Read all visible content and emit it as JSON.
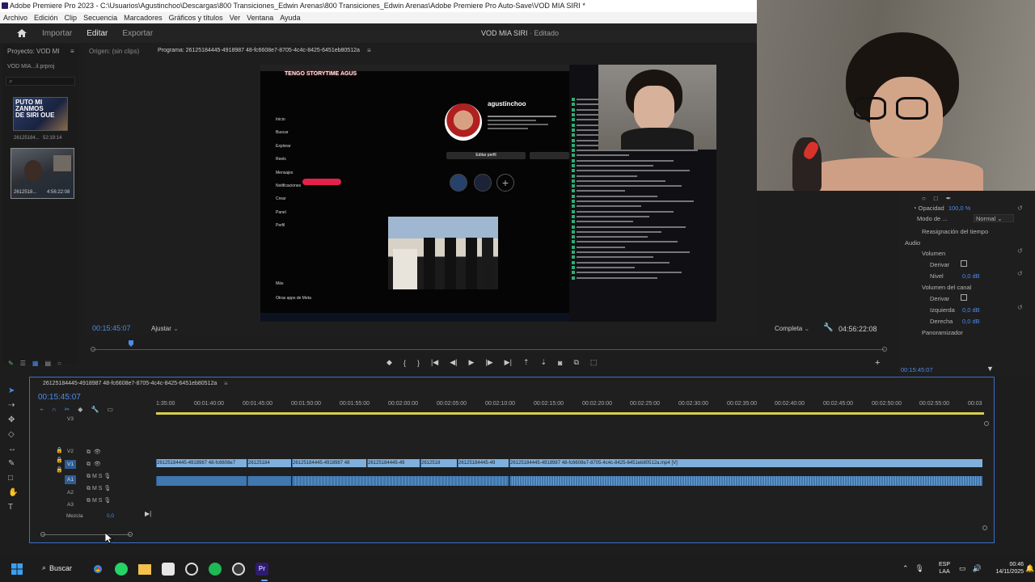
{
  "window": {
    "title": "Adobe Premiere Pro 2023 - C:\\Usuarios\\Agustinchoo\\Descargas\\800 Transiciones_Edwin Arenas\\800 Transiciones_Edwin Arenas\\Adobe Premiere Pro Auto-Save\\VOD MIA SIRI *"
  },
  "menu": [
    "Archivo",
    "Edición",
    "Clip",
    "Secuencia",
    "Marcadores",
    "Gráficos y títulos",
    "Ver",
    "Ventana",
    "Ayuda"
  ],
  "workspaces": {
    "home": "home-icon",
    "tabs": [
      "Importar",
      "Editar",
      "Exportar"
    ],
    "active": "Editar",
    "project_title": "VOD MIA SIRI",
    "status": "Editado"
  },
  "project_panel": {
    "tab": "Proyecto: VOD MI",
    "file": "VOD MIA...il.prproj",
    "items": [
      {
        "name": "26125184...",
        "duration": "52:19:14"
      },
      {
        "name": "2612518...",
        "duration": "4:56:22:08"
      }
    ]
  },
  "source_tab": "Origen: (sin clips)",
  "program_tab": "Programa: 26125184445-4918987 48-fc6608e7-8705-4c4c-8425-6451eb80512a",
  "program": {
    "timecode": "00:15:45:07",
    "fit": "Ajustar",
    "quality": "Completa",
    "duration": "04:56:22:08"
  },
  "stream_overlay": {
    "title": "TENGO STORYTIME AGUS",
    "user_handle": "agustinchoo",
    "insta_menu": [
      "Inicio",
      "Buscar",
      "Explorar",
      "Reels",
      "Mensajes",
      "Notificaciones",
      "Crear",
      "Panel",
      "Perfil",
      "Más",
      "Otras apps de Meta"
    ],
    "insta_edit": "Editar perfil"
  },
  "effects_panel": {
    "opacity_label": "Opacidad",
    "opacity_value": "100,0 %",
    "blend_label": "Modo de ...",
    "blend_value": "Normal",
    "time_remap": "Reasignación del tiempo",
    "audio": "Audio",
    "volume": "Volumen",
    "derivar": "Derivar",
    "nivel": "Nivel",
    "nivel_value": "0,0 dB",
    "channel_volume": "Volumen del canal",
    "derivar2": "Derivar",
    "izquierda": "Izquierda",
    "izquierda_value": "0,0 dB",
    "derecha": "Derecha",
    "derecha_value": "0,0 dB",
    "panner": "Panoramizador",
    "timecode": "00:15:45:07"
  },
  "timeline": {
    "sequence_tab": "26125184445-4918987 48-fc6608e7-8705-4c4c-8425-6451eb80512a",
    "timecode": "00:15:45:07",
    "ruler": [
      "1:35:00",
      "00:01:40:00",
      "00:01:45:00",
      "00:01:50:00",
      "00:01:55:00",
      "00:02:00:00",
      "00:02:05:00",
      "00:02:10:00",
      "00:02:15:00",
      "00:02:20:00",
      "00:02:25:00",
      "00:02:30:00",
      "00:02:35:00",
      "00:02:40:00",
      "00:02:45:00",
      "00:02:50:00",
      "00:02:55:00",
      "00:03"
    ],
    "tracks": {
      "v3": "V3",
      "v2": "V2",
      "v1": "V1",
      "a1": "A1",
      "a2": "A2",
      "a3": "A3",
      "mix": "Mezcla",
      "mix_value": "0,0"
    },
    "clips": [
      "26125184445-4918987 48-fc6608e7",
      "26125184",
      "26125184445-4918987 48",
      "26125184445-49",
      "2612518",
      "26125184445-49",
      "26125184445-4918987 48-fc6608e7-8705-4c4c-8425-6451eb80512a.mp4 [V]"
    ]
  },
  "taskbar": {
    "search_label": "Buscar",
    "lang": "ESP",
    "lang2": "LAA",
    "time": "00:46",
    "date": "14/11/2025"
  }
}
